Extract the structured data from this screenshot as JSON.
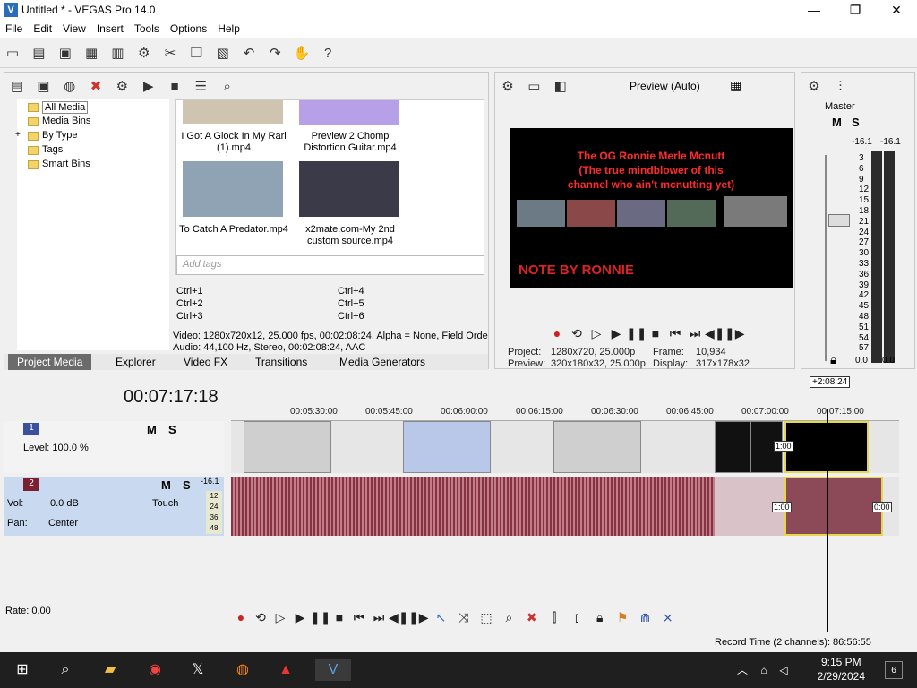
{
  "window": {
    "title": "Untitled * - VEGAS Pro 14.0",
    "app_icon": "V",
    "minimize": "—",
    "maximize": "❐",
    "close": "✕"
  },
  "menu": [
    "File",
    "Edit",
    "View",
    "Insert",
    "Tools",
    "Options",
    "Help"
  ],
  "media_tree": [
    "All Media",
    "Media Bins",
    "By Type",
    "Tags",
    "Smart Bins"
  ],
  "media_tree_expand": "+",
  "thumbnails": [
    {
      "label": "I Got A Glock In My Rari (1).mp4"
    },
    {
      "label": "Preview 2 Chomp Distortion Guitar.mp4"
    },
    {
      "label": "To Catch A Predator.mp4"
    },
    {
      "label": "x2mate.com-My 2nd custom source.mp4"
    }
  ],
  "tags_placeholder": "Add tags",
  "shortcuts": [
    "Ctrl+1",
    "Ctrl+2",
    "Ctrl+3",
    "Ctrl+4",
    "Ctrl+5",
    "Ctrl+6"
  ],
  "media_info": {
    "video": "Video: 1280x720x12, 25.000 fps, 00:02:08:24, Alpha = None, Field Orde",
    "audio": "Audio: 44,100 Hz, Stereo, 00:02:08:24, AAC"
  },
  "media_tabs": [
    "Project Media",
    "Explorer",
    "Video FX",
    "Transitions",
    "Media Generators"
  ],
  "preview": {
    "mode": "Preview (Auto)",
    "overlay_title": "The OG Ronnie Merle Mcnutt",
    "overlay_sub1": "(The true mindblower of this",
    "overlay_sub2": "channel who ain't mcnutting yet)",
    "watermark": "NOTE BY RONNIE",
    "project_label": "Project:",
    "project_value": "1280x720, 25.000p",
    "preview_label": "Preview:",
    "preview_value": "320x180x32, 25.000p",
    "frame_label": "Frame:",
    "frame_value": "10,934",
    "display_label": "Display:",
    "display_value": "317x178x32"
  },
  "master": {
    "title": "Master",
    "peak_left": "-16.1",
    "peak_right": "-16.1",
    "ticks": [
      "3",
      "6",
      "9",
      "12",
      "15",
      "18",
      "21",
      "24",
      "27",
      "30",
      "33",
      "36",
      "39",
      "42",
      "45",
      "48",
      "51",
      "54",
      "57"
    ],
    "val_left": "0.0",
    "val_right": "0.0"
  },
  "timeline": {
    "time": "00:07:17:18",
    "ruler": [
      "00:05:30:00",
      "00:05:45:00",
      "00:06:00:00",
      "00:06:15:00",
      "00:06:30:00",
      "00:06:45:00",
      "00:07:00:00",
      "00:07:15:00"
    ],
    "region_label": "+2:08:24",
    "marker1": "1:00",
    "marker2": "1:00",
    "marker3": "0:00"
  },
  "tracks": {
    "video": {
      "num": "1",
      "level": "Level: 100.0 %"
    },
    "audio": {
      "num": "2",
      "vol_label": "Vol:",
      "vol_value": "0.0 dB",
      "pan_label": "Pan:",
      "pan_value": "Center",
      "mode": "Touch",
      "peak": "-16.1",
      "ticks": [
        "12",
        "24",
        "36",
        "48"
      ]
    }
  },
  "rate": "Rate: 0.00",
  "status": "Record Time (2 channels): 86:56:55",
  "taskbar": {
    "time": "9:15 PM",
    "date": "2/29/2024",
    "notifications": "6"
  }
}
